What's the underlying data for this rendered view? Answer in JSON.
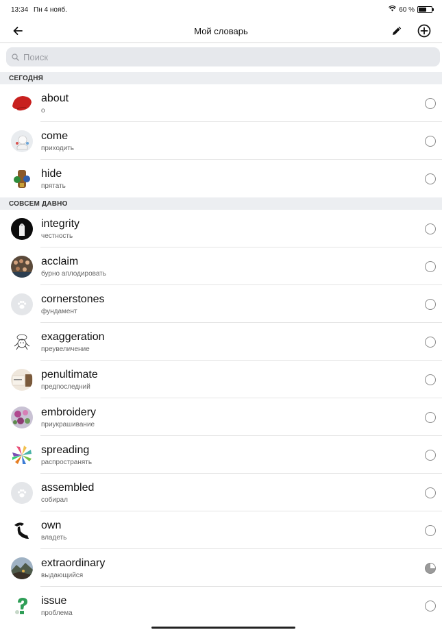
{
  "status": {
    "time": "13:34",
    "date": "Пн 4 нояб.",
    "battery": "60 %",
    "battery_level": 0.6
  },
  "nav": {
    "title": "Мой словарь",
    "back_icon": "arrow-left-icon",
    "edit_icon": "pencil-icon",
    "add_icon": "plus-circle-icon"
  },
  "search": {
    "placeholder": "Поиск",
    "value": ""
  },
  "sections": {
    "today": {
      "title": "СЕГОДНЯ",
      "items": [
        {
          "word": "about",
          "translation": "о"
        },
        {
          "word": "come",
          "translation": "приходить"
        },
        {
          "word": "hide",
          "translation": "прятать"
        }
      ]
    },
    "long_ago": {
      "title": "СОВСЕМ ДАВНО",
      "items": [
        {
          "word": "integrity",
          "translation": "честность"
        },
        {
          "word": "acclaim",
          "translation": "бурно аплодировать"
        },
        {
          "word": "cornerstones",
          "translation": "фундамент"
        },
        {
          "word": "exaggeration",
          "translation": "преувеличение"
        },
        {
          "word": "penultimate",
          "translation": "предпоследний"
        },
        {
          "word": "embroidery",
          "translation": "приукрашивание"
        },
        {
          "word": "spreading",
          "translation": "распространять"
        },
        {
          "word": "assembled",
          "translation": "собирал"
        },
        {
          "word": "own",
          "translation": "владеть"
        },
        {
          "word": "extraordinary",
          "translation": "выдающийся",
          "progress": 0.75
        },
        {
          "word": "issue",
          "translation": "проблема"
        }
      ]
    }
  },
  "colors": {
    "section_bg": "#eceef1",
    "search_bg": "#e6e8ec"
  }
}
